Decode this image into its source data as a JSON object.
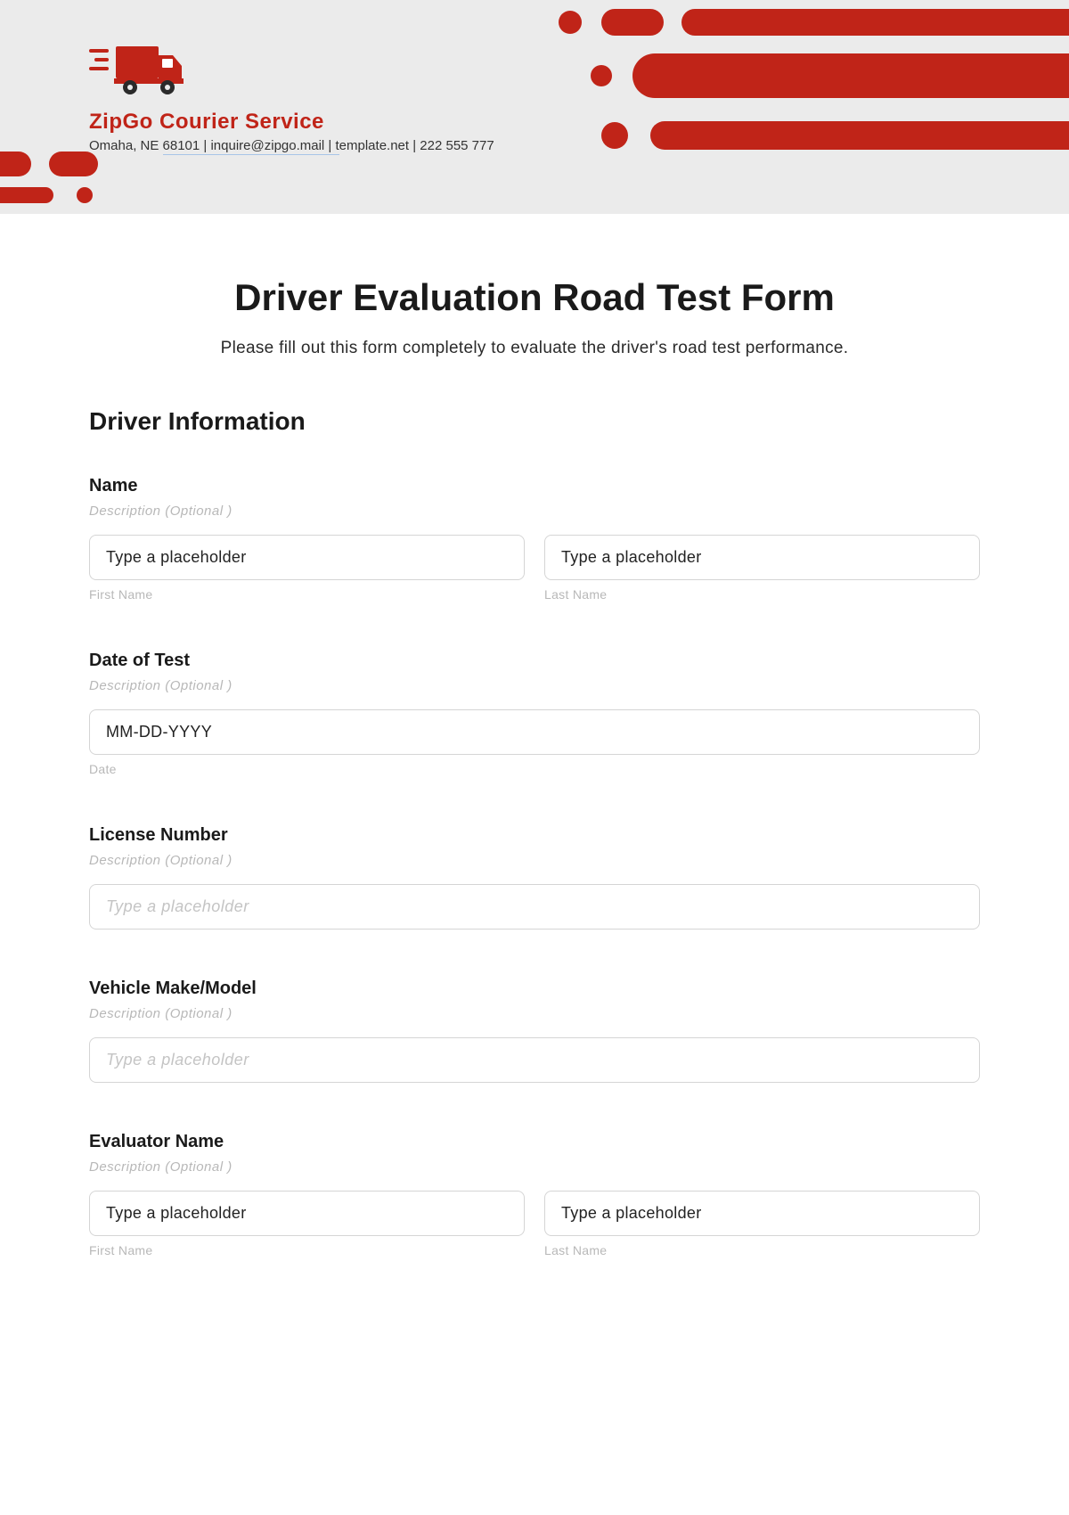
{
  "header": {
    "company_name": "ZipGo Courier Service",
    "address_part1": "Omaha, NE ",
    "address_underline": "68101 | inquire@zipgo.mail | t",
    "address_part2": "emplate.net | 222 555 777"
  },
  "form": {
    "title": "Driver Evaluation Road Test Form",
    "subtitle": "Please fill out this form completely to evaluate the driver's road test performance."
  },
  "section": {
    "driver_info": "Driver Information"
  },
  "fields": {
    "name": {
      "label": "Name",
      "desc": "Description (Optional )",
      "first_value": "Type a placeholder",
      "first_sublabel": "First Name",
      "last_value": "Type a placeholder",
      "last_sublabel": "Last Name"
    },
    "date": {
      "label": "Date of Test",
      "desc": "Description (Optional )",
      "value": "MM-DD-YYYY",
      "sublabel": "Date"
    },
    "license": {
      "label": "License Number",
      "desc": "Description (Optional )",
      "placeholder": "Type a placeholder"
    },
    "vehicle": {
      "label": "Vehicle Make/Model",
      "desc": "Description (Optional )",
      "placeholder": "Type a placeholder"
    },
    "evaluator": {
      "label": "Evaluator Name",
      "desc": "Description (Optional )",
      "first_value": "Type a placeholder",
      "first_sublabel": "First Name",
      "last_value": "Type a placeholder",
      "last_sublabel": "Last Name"
    }
  },
  "colors": {
    "brand_red": "#c02418",
    "header_bg": "#ebebeb"
  }
}
